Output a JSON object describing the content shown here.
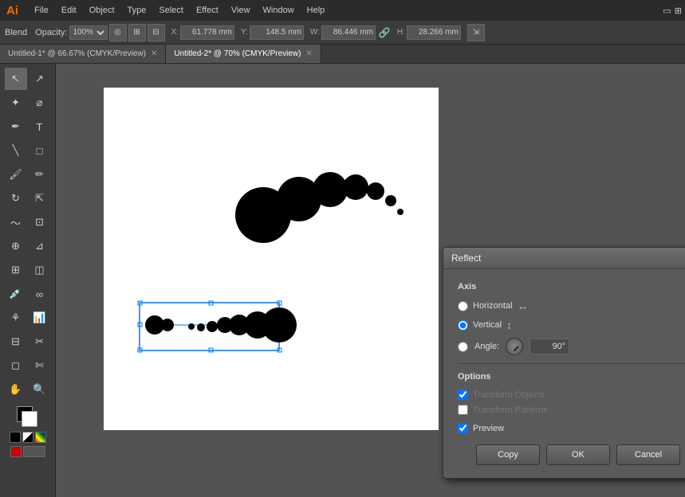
{
  "app": {
    "logo": "Ai",
    "menu_items": [
      "File",
      "Edit",
      "Object",
      "Type",
      "Select",
      "Effect",
      "View",
      "Window",
      "Help"
    ]
  },
  "toolbar": {
    "blend_label": "Blend",
    "opacity_label": "Opacity:",
    "opacity_value": "100%",
    "x_label": "X:",
    "x_value": "61.778 mm",
    "y_label": "Y:",
    "y_value": "148.5 mm",
    "w_label": "W:",
    "w_value": "86.446 mm",
    "h_label": "H:",
    "h_value": "28.266 mm"
  },
  "tabs": [
    {
      "label": "Untitled-1* @ 66.67% (CMYK/Preview)",
      "active": false
    },
    {
      "label": "Untitled-2* @ 70% (CMYK/Preview)",
      "active": true
    }
  ],
  "dialog": {
    "title": "Reflect",
    "axis_label": "Axis",
    "horizontal_label": "Horizontal",
    "vertical_label": "Vertical",
    "angle_label": "Angle:",
    "angle_value": "90°",
    "options_label": "Options",
    "transform_objects_label": "Transform Objects",
    "transform_patterns_label": "Transform Patterns",
    "preview_label": "Preview",
    "copy_btn": "Copy",
    "ok_btn": "OK",
    "cancel_btn": "Cancel"
  }
}
